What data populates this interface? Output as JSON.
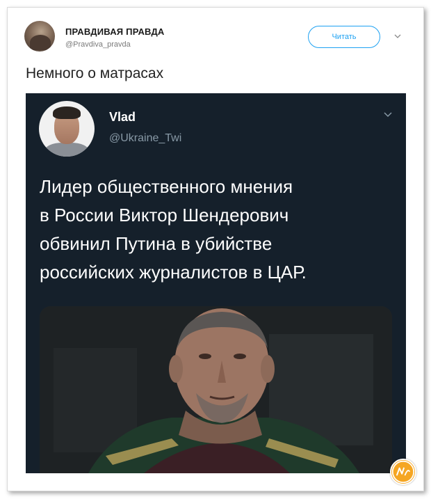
{
  "tweet": {
    "account_name": "ПРАВДИВАЯ ПРАВДА",
    "account_handle": "@Pravdiva_pravda",
    "follow_label": "Читать",
    "text": "Немного о матрасах"
  },
  "quoted": {
    "name": "Vlad",
    "handle": "@Ukraine_Twi",
    "lines": [
      "Лидер общественного мнения",
      "в России Виктор Шендерович",
      "обвинил Путина в убийстве",
      "российских журналистов в ЦАР."
    ],
    "background_color": "#15202b"
  },
  "colors": {
    "accent": "#1da1f2",
    "watermark": "#f5a623"
  },
  "icons": {
    "outer_menu": "chevron-down-icon",
    "inner_menu": "chevron-down-icon",
    "watermark": "nyka-logo"
  }
}
